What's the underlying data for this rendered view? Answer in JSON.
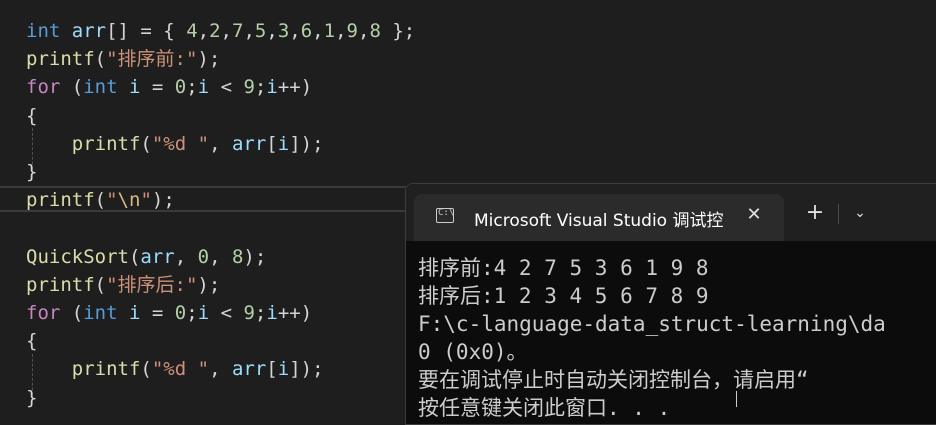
{
  "editor": {
    "lines": [
      {
        "tokens": [
          [
            "kw",
            "int"
          ],
          [
            "pl",
            " "
          ],
          [
            "var",
            "arr"
          ],
          [
            "pl",
            "[] = { "
          ],
          [
            "num",
            "4"
          ],
          [
            "pl",
            ","
          ],
          [
            "num",
            "2"
          ],
          [
            "pl",
            ","
          ],
          [
            "num",
            "7"
          ],
          [
            "pl",
            ","
          ],
          [
            "num",
            "5"
          ],
          [
            "pl",
            ","
          ],
          [
            "num",
            "3"
          ],
          [
            "pl",
            ","
          ],
          [
            "num",
            "6"
          ],
          [
            "pl",
            ","
          ],
          [
            "num",
            "1"
          ],
          [
            "pl",
            ","
          ],
          [
            "num",
            "9"
          ],
          [
            "pl",
            ","
          ],
          [
            "num",
            "8"
          ],
          [
            "pl",
            " };"
          ]
        ]
      },
      {
        "tokens": [
          [
            "fn",
            "printf"
          ],
          [
            "pl",
            "("
          ],
          [
            "str",
            "\"排序前:\""
          ],
          [
            "pl",
            ");"
          ]
        ]
      },
      {
        "tokens": [
          [
            "ctl",
            "for"
          ],
          [
            "pl",
            " ("
          ],
          [
            "kw",
            "int"
          ],
          [
            "pl",
            " "
          ],
          [
            "var",
            "i"
          ],
          [
            "pl",
            " = "
          ],
          [
            "num",
            "0"
          ],
          [
            "pl",
            ";"
          ],
          [
            "var",
            "i"
          ],
          [
            "pl",
            " < "
          ],
          [
            "num",
            "9"
          ],
          [
            "pl",
            ";"
          ],
          [
            "var",
            "i"
          ],
          [
            "pl",
            "++)"
          ]
        ]
      },
      {
        "tokens": [
          [
            "pl",
            "{"
          ]
        ]
      },
      {
        "tokens": [
          [
            "pl",
            "    "
          ],
          [
            "fn",
            "printf"
          ],
          [
            "pl",
            "("
          ],
          [
            "str",
            "\"%d \""
          ],
          [
            "pl",
            ", "
          ],
          [
            "var",
            "arr"
          ],
          [
            "pl",
            "["
          ],
          [
            "var",
            "i"
          ],
          [
            "pl",
            "]);"
          ]
        ]
      },
      {
        "tokens": [
          [
            "pl",
            "}"
          ]
        ]
      },
      {
        "tokens": [
          [
            "fn",
            "printf"
          ],
          [
            "pl",
            "("
          ],
          [
            "str",
            "\""
          ],
          [
            "esc",
            "\\n"
          ],
          [
            "str",
            "\""
          ],
          [
            "pl",
            ");"
          ]
        ]
      },
      {
        "tokens": []
      },
      {
        "tokens": [
          [
            "fn",
            "QuickSort"
          ],
          [
            "pl",
            "("
          ],
          [
            "var",
            "arr"
          ],
          [
            "pl",
            ", "
          ],
          [
            "num",
            "0"
          ],
          [
            "pl",
            ", "
          ],
          [
            "num",
            "8"
          ],
          [
            "pl",
            ");"
          ]
        ]
      },
      {
        "tokens": [
          [
            "fn",
            "printf"
          ],
          [
            "pl",
            "("
          ],
          [
            "str",
            "\"排序后:\""
          ],
          [
            "pl",
            ");"
          ]
        ]
      },
      {
        "tokens": [
          [
            "ctl",
            "for"
          ],
          [
            "pl",
            " ("
          ],
          [
            "kw",
            "int"
          ],
          [
            "pl",
            " "
          ],
          [
            "var",
            "i"
          ],
          [
            "pl",
            " = "
          ],
          [
            "num",
            "0"
          ],
          [
            "pl",
            ";"
          ],
          [
            "var",
            "i"
          ],
          [
            "pl",
            " < "
          ],
          [
            "num",
            "9"
          ],
          [
            "pl",
            ";"
          ],
          [
            "var",
            "i"
          ],
          [
            "pl",
            "++)"
          ]
        ]
      },
      {
        "tokens": [
          [
            "pl",
            "{"
          ]
        ]
      },
      {
        "tokens": [
          [
            "pl",
            "    "
          ],
          [
            "fn",
            "printf"
          ],
          [
            "pl",
            "("
          ],
          [
            "str",
            "\"%d \""
          ],
          [
            "pl",
            ", "
          ],
          [
            "var",
            "arr"
          ],
          [
            "pl",
            "["
          ],
          [
            "var",
            "i"
          ],
          [
            "pl",
            "]);"
          ]
        ]
      },
      {
        "tokens": [
          [
            "pl",
            "}"
          ]
        ]
      }
    ]
  },
  "terminal": {
    "tab_title": "Microsoft Visual Studio 调试控",
    "tab_icon": "console-icon",
    "close_glyph": "✕",
    "new_tab_glyph": "+",
    "dropdown_glyph": "⌄",
    "output": [
      "排序前:4 2 7 5 3 6 1 9 8",
      "排序后:1 2 3 4 5 6 7 8 9",
      "F:\\c-language-data_struct-learning\\da",
      "0 (0x0)。",
      "要在调试停止时自动关闭控制台，请启用“",
      "按任意键关闭此窗口. . ."
    ]
  }
}
